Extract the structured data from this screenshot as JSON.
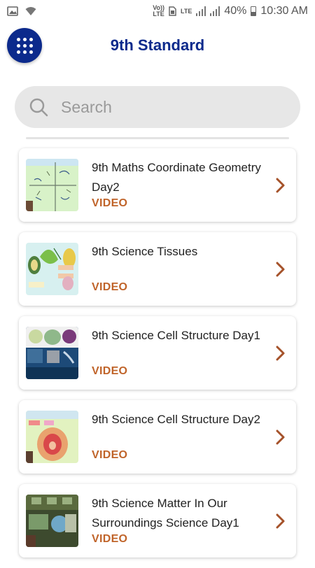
{
  "status_bar": {
    "left_icons": [
      "image-icon",
      "wifi-icon"
    ],
    "volte_top": "Vo))",
    "volte_bottom": "LTE",
    "lte": "LTE",
    "battery_percent": "40%",
    "time": "10:30 AM"
  },
  "header": {
    "menu_icon": "grid-menu-icon",
    "title": "9th Standard"
  },
  "search": {
    "placeholder": "Search",
    "value": ""
  },
  "list": {
    "chevron_color": "#a5522a",
    "type_color": "#c0642a",
    "items": [
      {
        "title": "9th Maths Coordinate Geometry Day2",
        "type": "VIDEO"
      },
      {
        "title": "9th Science Tissues",
        "type": "VIDEO"
      },
      {
        "title": "9th Science Cell Structure Day1",
        "type": "VIDEO"
      },
      {
        "title": "9th Science Cell Structure Day2",
        "type": "VIDEO"
      },
      {
        "title": "9th Science Matter In Our Surroundings Science Day1",
        "type": "VIDEO"
      }
    ]
  },
  "colors": {
    "accent": "#0c2a8c",
    "search_bg": "#e7e7e7"
  }
}
